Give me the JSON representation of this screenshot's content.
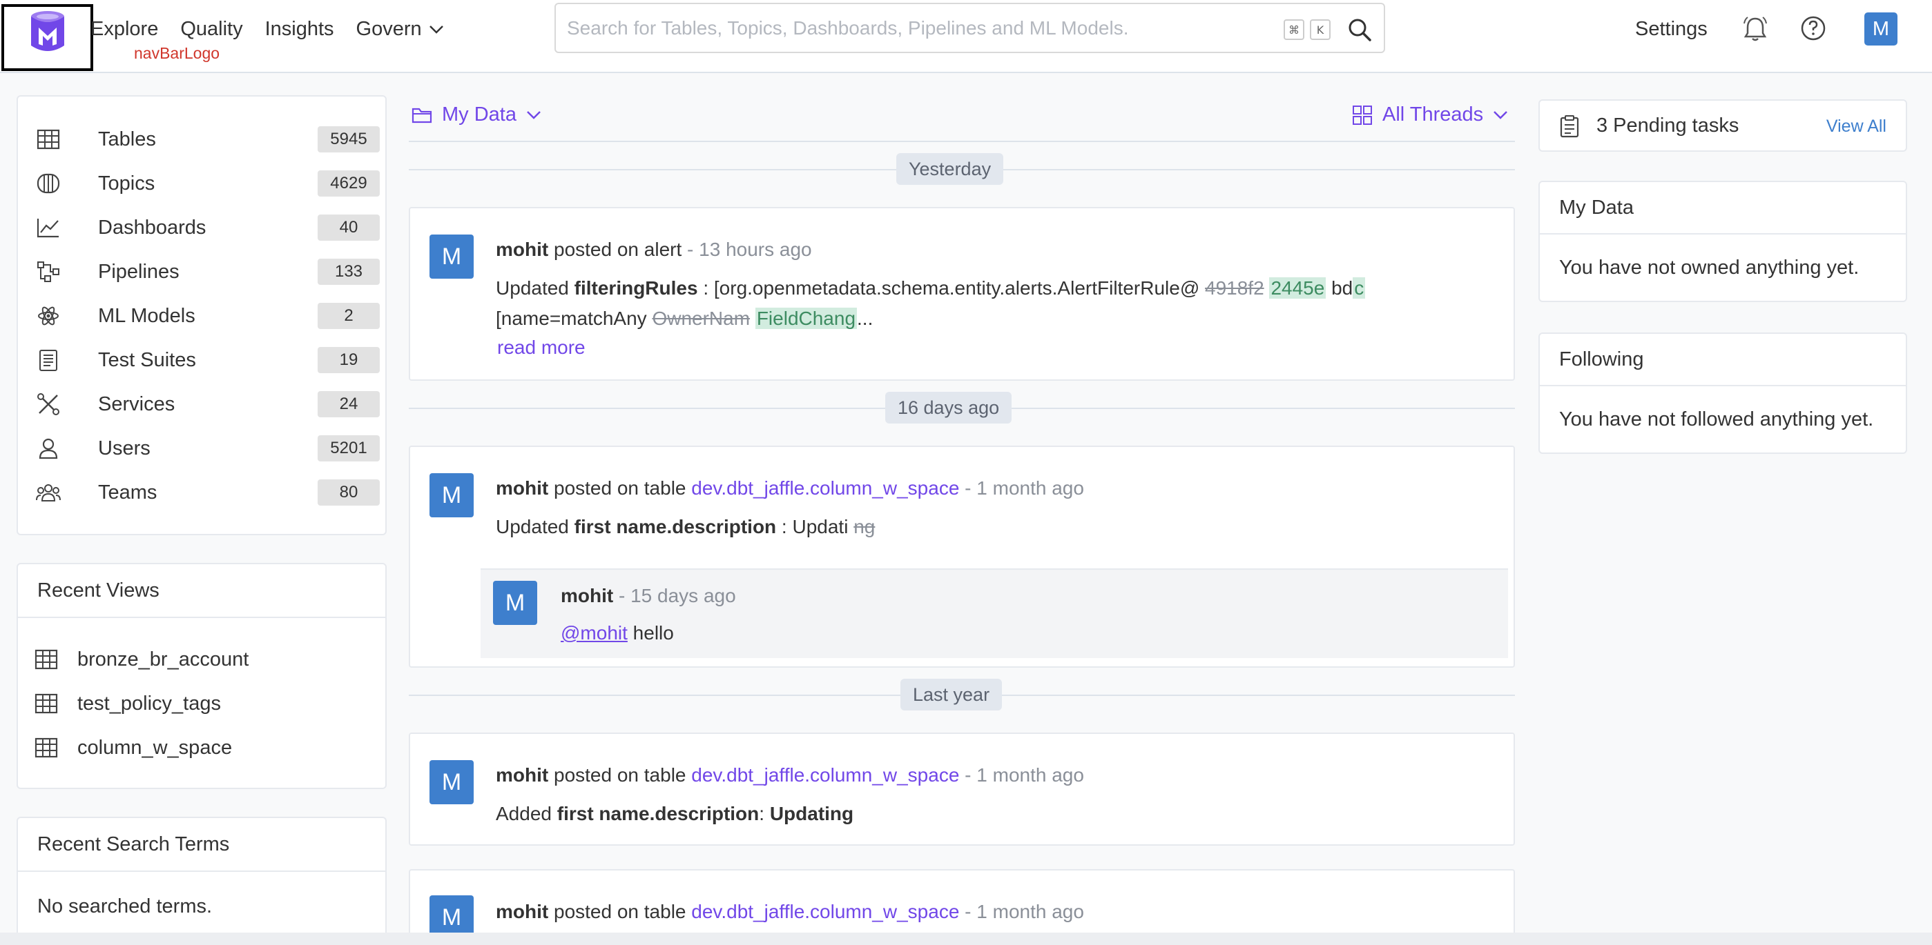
{
  "nav": {
    "logo_label": "navBarLogo",
    "menu": [
      {
        "label": "Explore"
      },
      {
        "label": "Quality"
      },
      {
        "label": "Insights"
      },
      {
        "label": "Govern",
        "has_dropdown": true
      }
    ],
    "search_placeholder": "Search for Tables, Topics, Dashboards, Pipelines and ML Models.",
    "shortcut_keys": [
      "⌘",
      "K"
    ],
    "settings_label": "Settings",
    "user_initial": "M"
  },
  "entities": [
    {
      "label": "Tables",
      "count": "5945",
      "icon": "table-icon"
    },
    {
      "label": "Topics",
      "count": "4629",
      "icon": "topic-icon"
    },
    {
      "label": "Dashboards",
      "count": "40",
      "icon": "dashboard-icon"
    },
    {
      "label": "Pipelines",
      "count": "133",
      "icon": "pipeline-icon"
    },
    {
      "label": "ML Models",
      "count": "2",
      "icon": "ml-model-icon"
    },
    {
      "label": "Test Suites",
      "count": "19",
      "icon": "test-suite-icon"
    },
    {
      "label": "Services",
      "count": "24",
      "icon": "services-icon"
    },
    {
      "label": "Users",
      "count": "5201",
      "icon": "user-icon"
    },
    {
      "label": "Teams",
      "count": "80",
      "icon": "teams-icon"
    }
  ],
  "recent_views": {
    "title": "Recent Views",
    "items": [
      "bronze_br_account",
      "test_policy_tags",
      "column_w_space"
    ]
  },
  "recent_search": {
    "title": "Recent Search Terms",
    "empty": "No searched terms."
  },
  "feed": {
    "filter_label": "My Data",
    "threads_label": "All Threads",
    "dividers": [
      "Yesterday",
      "16 days ago",
      "Last year"
    ],
    "posts": [
      {
        "avatar": "M",
        "author": "mohit",
        "action": "posted on alert",
        "entity": "",
        "time": "13 hours ago",
        "line1_prefix": "Updated ",
        "field": "filteringRules",
        "line1_mid": " : [org.openmetadata.schema.entity.alerts.AlertFilterRule@ ",
        "del1": "4918f2",
        "ins1": "2445e",
        "line1_plain": " bd",
        "ins2": "c",
        "line2_prefix": "[name=matchAny ",
        "del2": "OwnerNam",
        "ins3": "FieldChang",
        "line2_suffix": "...",
        "read_more": "read more"
      },
      {
        "avatar": "M",
        "author": "mohit",
        "action": "posted on table",
        "entity": "dev.dbt_jaffle.column_w_space",
        "time": "1 month ago",
        "body_prefix": "Updated ",
        "field": "first name.description",
        "body_mid": " : Updati ",
        "del": "ng",
        "reply": {
          "avatar": "M",
          "author": "mohit",
          "time": "15 days ago",
          "mention": "@mohit",
          "text": " hello"
        }
      },
      {
        "avatar": "M",
        "author": "mohit",
        "action": "posted on table",
        "entity": "dev.dbt_jaffle.column_w_space",
        "time": "1 month ago",
        "body_prefix": "Added ",
        "field": "first name.description",
        "body_sep": ": ",
        "value": "Updating"
      },
      {
        "avatar": "M",
        "author": "mohit",
        "action": "posted on table",
        "entity": "dev.dbt_jaffle.column_w_space",
        "time": "1 month ago"
      }
    ]
  },
  "tasks": {
    "label": "3 Pending tasks",
    "view_all": "View All"
  },
  "my_data": {
    "title": "My Data",
    "empty": "You have not owned anything yet."
  },
  "following": {
    "title": "Following",
    "empty": "You have not followed anything yet."
  },
  "colors": {
    "accent": "#7147e8",
    "avatar": "#3e7fcd",
    "logo_frame": "#000000"
  }
}
